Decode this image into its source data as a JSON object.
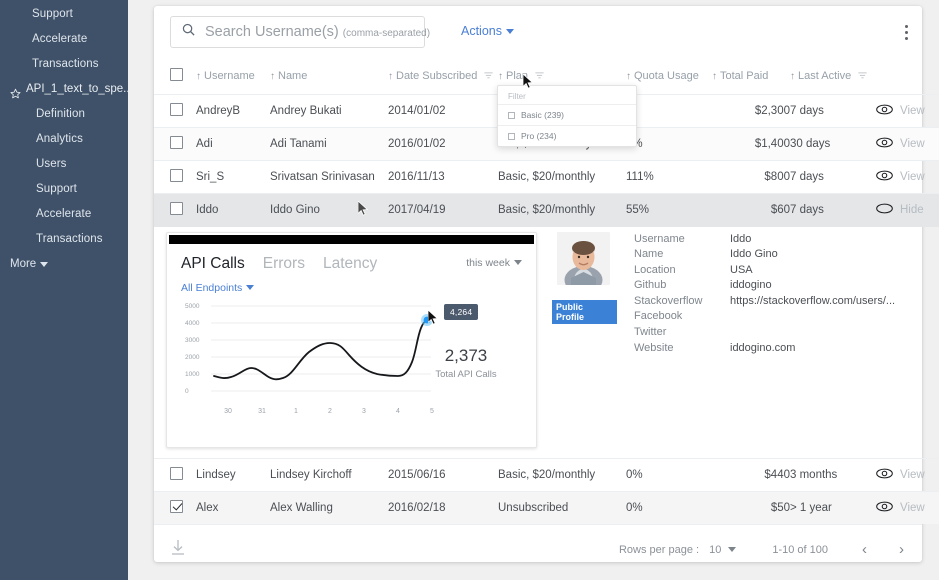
{
  "sidebar": {
    "top_items": [
      {
        "label": "Support"
      },
      {
        "label": "Accelerate"
      },
      {
        "label": "Transactions"
      }
    ],
    "api_group": {
      "label": "API_1_text_to_spe...",
      "icon": "star-icon"
    },
    "sub_items": [
      {
        "label": "Definition"
      },
      {
        "label": "Analytics"
      },
      {
        "label": "Users"
      },
      {
        "label": "Support"
      },
      {
        "label": "Accelerate"
      },
      {
        "label": "Transactions"
      }
    ],
    "more_label": "More"
  },
  "toolbar": {
    "search_placeholder": "Search Username(s)",
    "search_hint": "(comma-separated)",
    "search_value": "",
    "search_icon": "search-icon",
    "actions_label": "Actions",
    "kebab_icon": "more-vertical-icon"
  },
  "table": {
    "columns": [
      {
        "key": "checkbox",
        "label": "",
        "sortable": false,
        "filterable": false
      },
      {
        "key": "username",
        "label": "Username",
        "sortable": true,
        "filterable": false
      },
      {
        "key": "name",
        "label": "Name",
        "sortable": true,
        "filterable": false
      },
      {
        "key": "date_subscribed",
        "label": "Date Subscribed",
        "sortable": true,
        "filterable": true
      },
      {
        "key": "plan",
        "label": "Plan",
        "sortable": true,
        "filterable": true
      },
      {
        "key": "quota_usage",
        "label": "Quota Usage",
        "sortable": true,
        "filterable": false
      },
      {
        "key": "total_paid",
        "label": "Total Paid",
        "sortable": true,
        "filterable": false
      },
      {
        "key": "last_active",
        "label": "Last Active",
        "sortable": true,
        "filterable": true
      },
      {
        "key": "action",
        "label": "",
        "sortable": false,
        "filterable": false
      }
    ],
    "rows": [
      {
        "checked": false,
        "username": "AndreyB",
        "name": "Andrey Bukati",
        "date_subscribed": "2014/01/02",
        "plan": "",
        "quota_usage": "",
        "total_paid": "$2,300",
        "last_active": "7 days",
        "action_label": "View",
        "action_icon": "eye-open-icon",
        "quota_over": false
      },
      {
        "checked": false,
        "username": "Adi",
        "name": "Adi Tanami",
        "date_subscribed": "2016/01/02",
        "plan": "Pro, $300/monthly",
        "quota_usage": "2%",
        "total_paid": "$1,400",
        "last_active": "30 days",
        "action_label": "View",
        "action_icon": "eye-open-icon",
        "quota_over": false
      },
      {
        "checked": false,
        "username": "Sri_S",
        "name": "Srivatsan Srinivasan",
        "date_subscribed": "2016/11/13",
        "plan": "Basic, $20/monthly",
        "quota_usage": "111%",
        "total_paid": "$800",
        "last_active": "7 days",
        "action_label": "View",
        "action_icon": "eye-open-icon",
        "quota_over": true
      },
      {
        "checked": false,
        "username": "Iddo",
        "name": "Iddo Gino",
        "date_subscribed": "2017/04/19",
        "plan": "Basic, $20/monthly",
        "quota_usage": "55%",
        "total_paid": "$60",
        "last_active": "7 days",
        "action_label": "Hide",
        "action_icon": "eye-closed-icon",
        "quota_over": false
      }
    ],
    "rows_after": [
      {
        "checked": false,
        "username": "Lindsey",
        "name": "Lindsey Kirchoff",
        "date_subscribed": "2015/06/16",
        "plan": "Basic, $20/monthly",
        "quota_usage": "0%",
        "total_paid": "$440",
        "last_active": "3 months",
        "action_label": "View",
        "action_icon": "eye-open-icon",
        "quota_over": false
      },
      {
        "checked": true,
        "username": "Alex",
        "name": "Alex Walling",
        "date_subscribed": "2016/02/18",
        "plan": "Unsubscribed",
        "quota_usage": "0%",
        "total_paid": "$50",
        "last_active": "> 1 year",
        "action_label": "View",
        "action_icon": "eye-open-icon",
        "quota_over": false
      }
    ]
  },
  "filter_popup": {
    "title": "Filter",
    "options": [
      {
        "label": "Basic (239)",
        "checked": false
      },
      {
        "label": "Pro (234)",
        "checked": false
      }
    ]
  },
  "detail": {
    "tabs": [
      {
        "label": "API Calls",
        "active": true
      },
      {
        "label": "Errors",
        "active": false
      },
      {
        "label": "Latency",
        "active": false
      }
    ],
    "range_label": "this week",
    "endpoints_label": "All Endpoints",
    "total_value": "2,373",
    "total_label": "Total API Calls",
    "tooltip_value": "4,264",
    "profile": {
      "badge_label": "Public Profile",
      "avatar_icon": "user-avatar",
      "fields": [
        {
          "key": "Username",
          "value": "Iddo"
        },
        {
          "key": "Name",
          "value": "Iddo Gino"
        },
        {
          "key": "Location",
          "value": "USA"
        },
        {
          "key": "Github",
          "value": "iddogino"
        },
        {
          "key": "Stackoverflow",
          "value": "https://stackoverflow.com/users/..."
        },
        {
          "key": "Facebook",
          "value": ""
        },
        {
          "key": "Twitter",
          "value": ""
        },
        {
          "key": "Website",
          "value": "iddogino.com"
        }
      ]
    }
  },
  "chart_data": {
    "type": "line",
    "title": "API Calls",
    "xlabel": "",
    "ylabel": "",
    "x": [
      "30",
      "31",
      "1",
      "2",
      "3",
      "4",
      "5"
    ],
    "values": [
      880,
      760,
      1350,
      900,
      3080,
      1750,
      1080,
      1020,
      4264
    ],
    "x_positions": [
      0,
      0.5,
      1.1,
      1.7,
      2.55,
      3.3,
      3.95,
      4.3,
      4.62
    ],
    "ylim": [
      0,
      5000
    ],
    "yticks": [
      0,
      1000,
      2000,
      3000,
      4000,
      5000
    ],
    "ytick_labels": [
      "0",
      "1000",
      "2000",
      "3000",
      "4000",
      "5000"
    ],
    "grid": true,
    "legend": false,
    "highlight_point": {
      "x": "4.62",
      "y": 4264,
      "label": "4,264"
    },
    "summary_value": "2,373",
    "summary_label": "Total API Calls",
    "line_color": "#16181b"
  },
  "footer": {
    "download_icon": "download-icon",
    "rows_per_page_label": "Rows per page :",
    "rows_per_page_value": "10",
    "range_label": "1-10 of 100",
    "prev_icon": "chevron-left-icon",
    "next_icon": "chevron-right-icon"
  },
  "colors": {
    "sidebar_bg": "#3f5168",
    "accent_blue": "#4a7fd4",
    "badge_blue": "#3b82d6",
    "danger_red": "#e04b4b",
    "tooltip_bg": "#4c5a6e"
  }
}
